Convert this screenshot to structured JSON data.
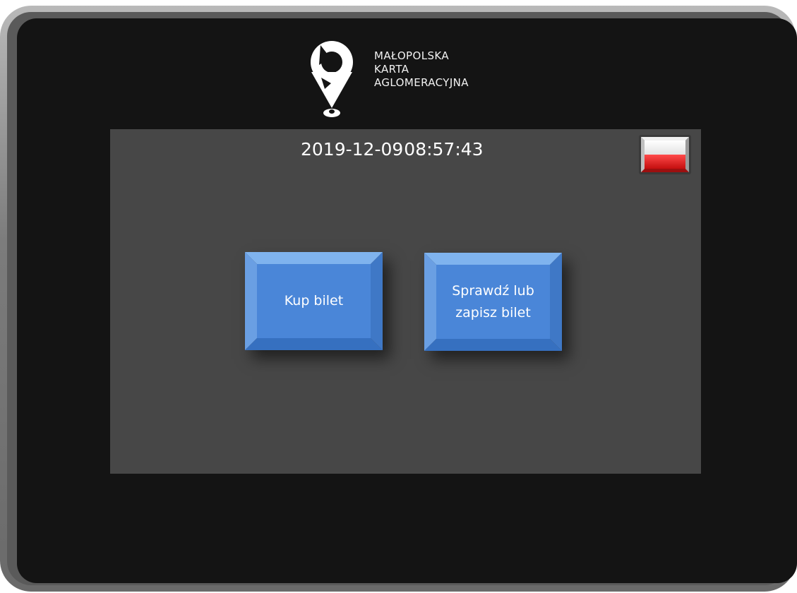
{
  "brand": {
    "line1": "MAŁOPOLSKA",
    "line2": "KARTA",
    "line3": "AGLOMERACYJNA",
    "logo_icon": "map-pin-logo-icon"
  },
  "status": {
    "date": "2019-12-09",
    "time": "08:57:43"
  },
  "language": {
    "icon": "poland-flag-icon",
    "colors": {
      "top": "#ffffff",
      "bottom": "#dc143c"
    }
  },
  "actions": {
    "buy_ticket_label": "Kup bilet",
    "check_ticket_label": "Sprawdź lub zapisz bilet"
  },
  "colors": {
    "button_blue": "#4a86d8",
    "screen_background": "#474747",
    "bezel": "#141414"
  }
}
